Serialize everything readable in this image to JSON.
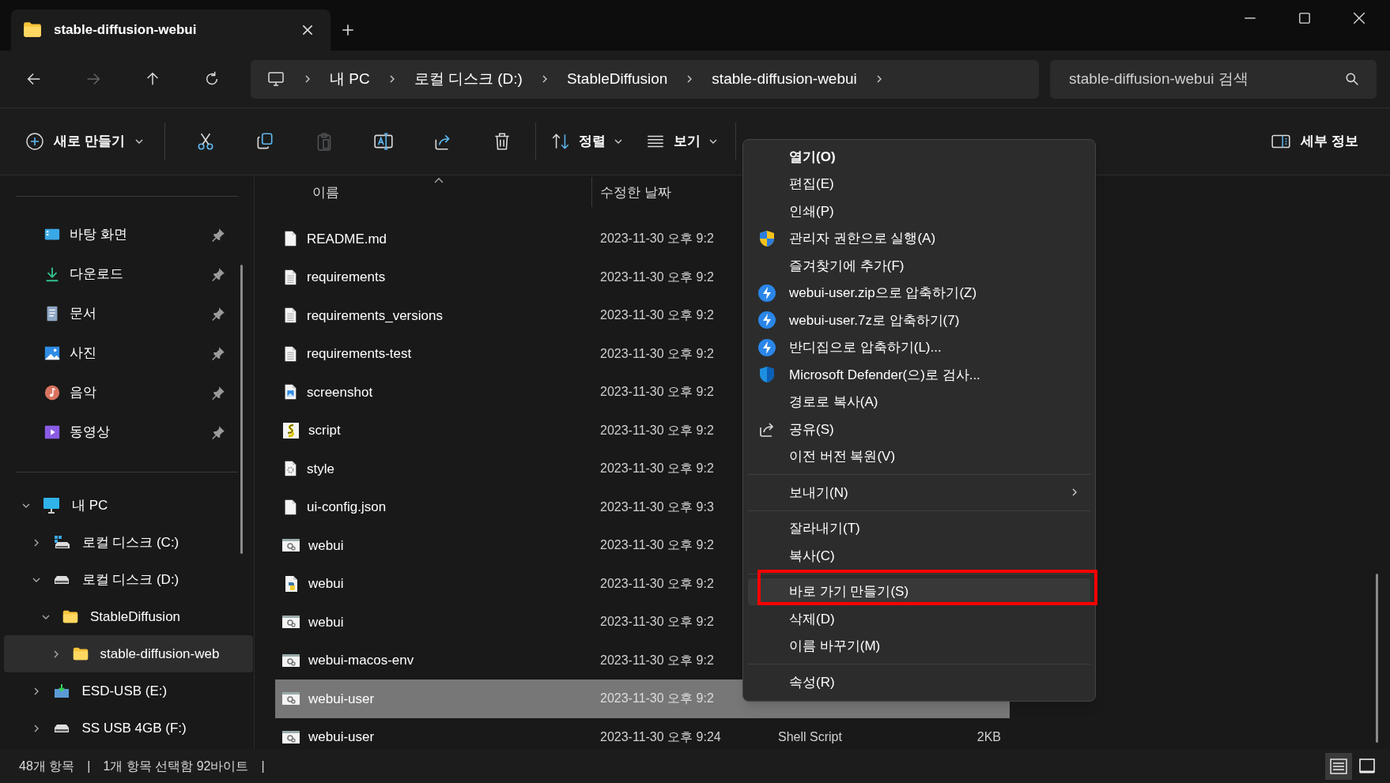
{
  "tab": {
    "title": "stable-diffusion-webui"
  },
  "breadcrumb": [
    "내 PC",
    "로컬 디스크 (D:)",
    "StableDiffusion",
    "stable-diffusion-webui"
  ],
  "search": {
    "placeholder": "stable-diffusion-webui 검색"
  },
  "toolbar": {
    "new_label": "새로 만들기",
    "sort_label": "정렬",
    "view_label": "보기",
    "details_label": "세부 정보",
    "actions": [
      {
        "kind": "cut",
        "disabled": false
      },
      {
        "kind": "copy",
        "disabled": false
      },
      {
        "kind": "paste",
        "disabled": true
      },
      {
        "kind": "rename",
        "disabled": false
      },
      {
        "kind": "share",
        "disabled": false
      },
      {
        "kind": "delete",
        "disabled": false
      }
    ]
  },
  "quick_access": [
    {
      "label": "바탕 화면",
      "kind": "desktop"
    },
    {
      "label": "다운로드",
      "kind": "download"
    },
    {
      "label": "문서",
      "kind": "documents"
    },
    {
      "label": "사진",
      "kind": "pictures"
    },
    {
      "label": "음악",
      "kind": "music"
    },
    {
      "label": "동영상",
      "kind": "videos"
    }
  ],
  "tree": [
    {
      "label": "내 PC",
      "kind": "pc",
      "expanded": true,
      "selected": false,
      "children": [
        {
          "label": "로컬 디스크 (C:)",
          "kind": "system-drive",
          "expanded": false,
          "selected": false
        },
        {
          "label": "로컬 디스크 (D:)",
          "kind": "drive",
          "expanded": true,
          "selected": false,
          "children": [
            {
              "label": "StableDiffusion",
              "kind": "folder",
              "expanded": true,
              "selected": false,
              "children": [
                {
                  "label": "stable-diffusion-web",
                  "kind": "folder",
                  "expanded": false,
                  "selected": true
                }
              ]
            }
          ]
        },
        {
          "label": "ESD-USB (E:)",
          "kind": "usb",
          "expanded": false,
          "selected": false
        },
        {
          "label": "SS USB 4GB (F:)",
          "kind": "drive",
          "expanded": false,
          "selected": false
        }
      ]
    }
  ],
  "columns": [
    "이름",
    "수정한 날짜"
  ],
  "files": [
    {
      "name": "README.md",
      "kind": "blank",
      "date": "2023-11-30 오후 9:2",
      "selected": false
    },
    {
      "name": "requirements",
      "kind": "text",
      "date": "2023-11-30 오후 9:2",
      "selected": false
    },
    {
      "name": "requirements_versions",
      "kind": "text",
      "date": "2023-11-30 오후 9:2",
      "selected": false
    },
    {
      "name": "requirements-test",
      "kind": "text",
      "date": "2023-11-30 오후 9:2",
      "selected": false
    },
    {
      "name": "screenshot",
      "kind": "image",
      "date": "2023-11-30 오후 9:2",
      "selected": false
    },
    {
      "name": "script",
      "kind": "script",
      "date": "2023-11-30 오후 9:2",
      "selected": false
    },
    {
      "name": "style",
      "kind": "settings",
      "date": "2023-11-30 오후 9:2",
      "selected": false
    },
    {
      "name": "ui-config.json",
      "kind": "blank",
      "date": "2023-11-30 오후 9:3",
      "selected": false
    },
    {
      "name": "webui",
      "kind": "batch",
      "date": "2023-11-30 오후 9:2",
      "selected": false
    },
    {
      "name": "webui",
      "kind": "python",
      "date": "2023-11-30 오후 9:2",
      "selected": false
    },
    {
      "name": "webui",
      "kind": "batch",
      "date": "2023-11-30 오후 9:2",
      "selected": false
    },
    {
      "name": "webui-macos-env",
      "kind": "batch",
      "date": "2023-11-30 오후 9:2",
      "selected": false
    },
    {
      "name": "webui-user",
      "kind": "batch",
      "date": "2023-11-30 오후 9:2",
      "selected": true
    },
    {
      "name": "webui-user",
      "kind": "batch",
      "date": "2023-11-30 오후 9:24",
      "type": "Shell Script",
      "size": "2KB",
      "selected": false
    }
  ],
  "context_menu": [
    {
      "kind": "default",
      "label": "열기(O)",
      "selected": false
    },
    {
      "kind": "plain",
      "label": "편집(E)",
      "selected": false
    },
    {
      "kind": "plain",
      "label": "인쇄(P)",
      "selected": false
    },
    {
      "kind": "shield",
      "label": "관리자 권한으로 실행(A)",
      "selected": false
    },
    {
      "kind": "plain",
      "label": "즐겨찾기에 추가(F)",
      "selected": false
    },
    {
      "kind": "bandizip",
      "label": "webui-user.zip으로 압축하기(Z)",
      "selected": false
    },
    {
      "kind": "bandizip",
      "label": "webui-user.7z로 압축하기(7)",
      "selected": false
    },
    {
      "kind": "bandizip",
      "label": "반디집으로 압축하기(L)...",
      "selected": false
    },
    {
      "kind": "defender",
      "label": "Microsoft Defender(으)로 검사...",
      "selected": false
    },
    {
      "kind": "plain",
      "label": "경로로 복사(A)",
      "selected": false
    },
    {
      "kind": "share",
      "label": "공유(S)",
      "selected": false
    },
    {
      "kind": "plain",
      "label": "이전 버전 복원(V)",
      "selected": false
    },
    {
      "kind": "separator"
    },
    {
      "kind": "submenu",
      "label": "보내기(N)",
      "selected": false
    },
    {
      "kind": "separator"
    },
    {
      "kind": "plain",
      "label": "잘라내기(T)",
      "selected": false
    },
    {
      "kind": "plain",
      "label": "복사(C)",
      "selected": false
    },
    {
      "kind": "separator"
    },
    {
      "kind": "plain",
      "label": "바로 가기 만들기(S)",
      "selected": true,
      "annotated": true
    },
    {
      "kind": "plain",
      "label": "삭제(D)",
      "selected": false
    },
    {
      "kind": "plain",
      "label": "이름 바꾸기(M)",
      "selected": false
    },
    {
      "kind": "separator"
    },
    {
      "kind": "plain",
      "label": "속성(R)",
      "selected": false
    }
  ],
  "status_bar": [
    "48개 항목",
    "|",
    "1개 항목 선택함 92바이트",
    "|"
  ],
  "view_buttons": [
    {
      "kind": "details",
      "selected": true
    },
    {
      "kind": "tiles",
      "selected": false
    }
  ]
}
